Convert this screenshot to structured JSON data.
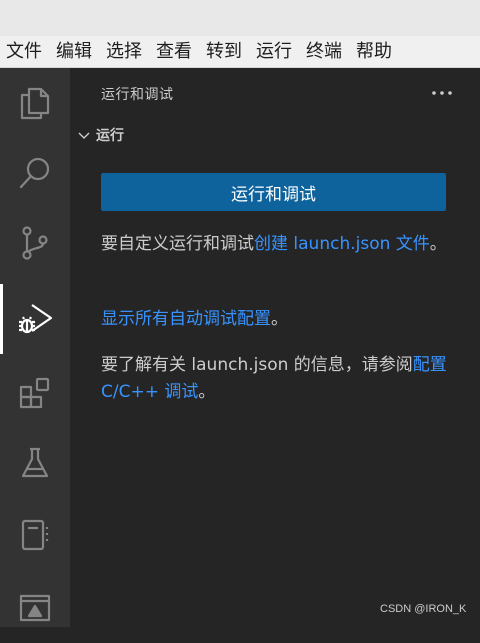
{
  "menubar": {
    "items": [
      "文件",
      "编辑",
      "选择",
      "查看",
      "转到",
      "运行",
      "终端",
      "帮助"
    ]
  },
  "activity_bar": {
    "items": [
      "explorer-icon",
      "search-icon",
      "source-control-icon",
      "run-debug-icon",
      "extensions-icon",
      "testing-icon",
      "notebook-icon",
      "remote-explorer-icon"
    ],
    "active": "run-debug-icon"
  },
  "sidebar": {
    "title": "运行和调试",
    "more_label": "···",
    "section": {
      "title": "运行"
    },
    "run_button_label": "运行和调试",
    "para1": {
      "text": "要自定义运行和调试",
      "link": "创建 launch.json 文件",
      "suffix": "。"
    },
    "para2": {
      "link": "显示所有自动调试配置",
      "suffix": "。"
    },
    "para3": {
      "text": "要了解有关 launch.json 的信息，请参阅",
      "link": "配置 C/C++ 调试",
      "suffix": "。"
    }
  },
  "watermark": "CSDN @IRON_K",
  "colors": {
    "accent": "#0e639c",
    "link": "#3794ff",
    "sidebar_bg": "#252526",
    "activity_bg": "#333333",
    "icon_inactive": "#858585",
    "icon_active": "#ffffff"
  }
}
